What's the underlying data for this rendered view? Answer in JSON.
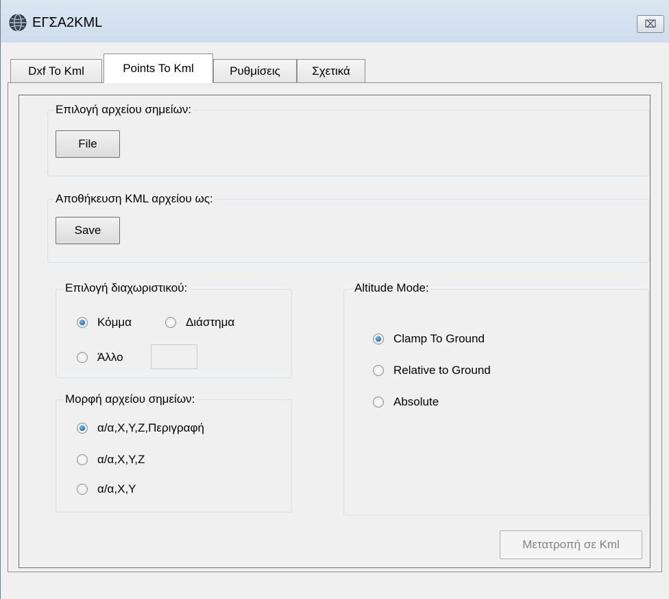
{
  "window": {
    "title": "ΕΓΣΑ2KML",
    "close_glyph": "⌧"
  },
  "tabs": [
    {
      "label": "Dxf To Kml",
      "active": false
    },
    {
      "label": "Points To Kml",
      "active": true
    },
    {
      "label": "Ρυθμίσεις",
      "active": false
    },
    {
      "label": "Σχετικά",
      "active": false
    }
  ],
  "file_group": {
    "label": "Επιλογή αρχείου σημείων:",
    "button": "File"
  },
  "save_group": {
    "label": "Αποθήκευση KML αρχείου ως:",
    "button": "Save"
  },
  "separator_group": {
    "label": "Επιλογή διαχωριστικού:",
    "options": [
      {
        "label": "Κόμμα",
        "checked": true
      },
      {
        "label": "Διάστημα",
        "checked": false
      },
      {
        "label": "Άλλο",
        "checked": false
      }
    ],
    "other_value": ""
  },
  "format_group": {
    "label": "Μορφή αρχείου σημείων:",
    "options": [
      {
        "label": "α/α,X,Y,Z,Περιγραφή",
        "checked": true
      },
      {
        "label": "α/α,X,Y,Z",
        "checked": false
      },
      {
        "label": "α/α,X,Y",
        "checked": false
      }
    ]
  },
  "altitude_group": {
    "label": "Altitude Mode:",
    "options": [
      {
        "label": "Clamp To Ground",
        "checked": true
      },
      {
        "label": "Relative to Ground",
        "checked": false
      },
      {
        "label": "Absolute",
        "checked": false
      }
    ]
  },
  "convert_button": {
    "label": "Μετατροπή σε  Kml",
    "enabled": false
  },
  "colors": {
    "title_bar": "#cfdcec",
    "background": "#f0f0f0",
    "radio_checked": "#1c6fb6"
  }
}
